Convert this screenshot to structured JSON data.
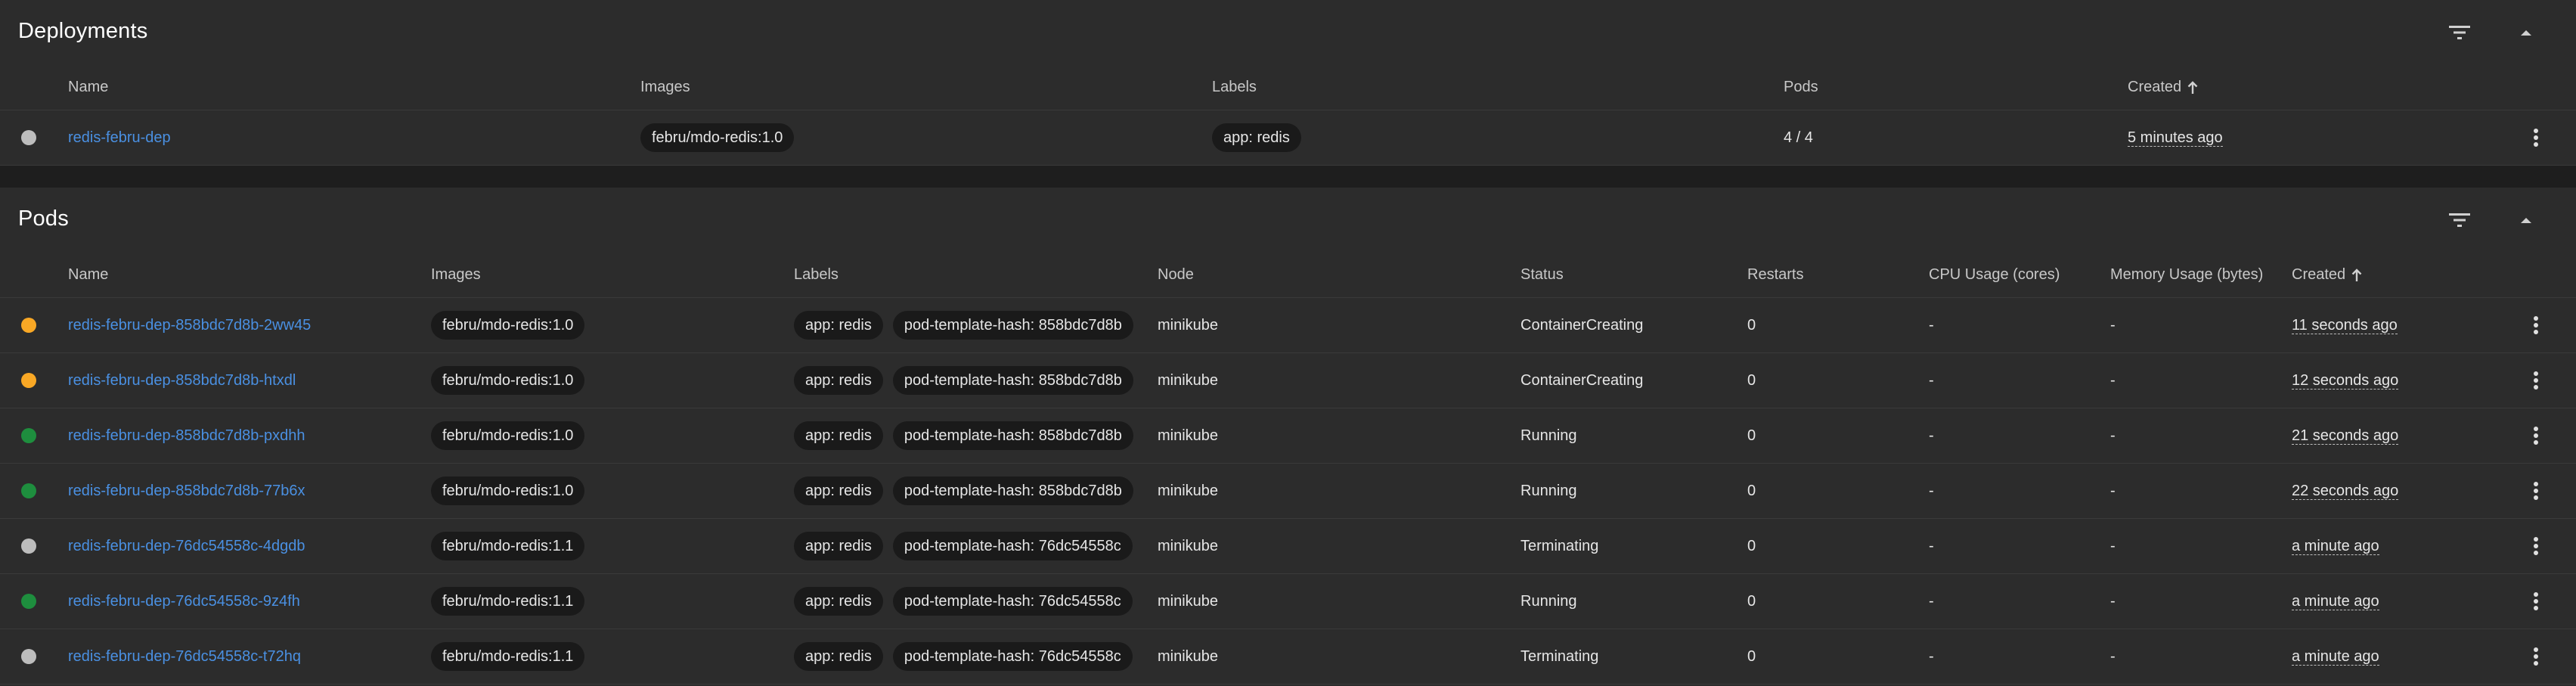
{
  "deployments": {
    "title": "Deployments",
    "columns": {
      "name": "Name",
      "images": "Images",
      "labels": "Labels",
      "pods": "Pods",
      "created": "Created"
    },
    "rows": [
      {
        "status_color": "#bdbdbd",
        "name": "redis-febru-dep",
        "images": [
          "febru/mdo-redis:1.0"
        ],
        "labels": [
          "app: redis"
        ],
        "pods": "4 / 4",
        "created": "5 minutes ago"
      }
    ]
  },
  "pods": {
    "title": "Pods",
    "columns": {
      "name": "Name",
      "images": "Images",
      "labels": "Labels",
      "node": "Node",
      "status": "Status",
      "restarts": "Restarts",
      "cpu": "CPU Usage (cores)",
      "memory": "Memory Usage (bytes)",
      "created": "Created"
    },
    "rows": [
      {
        "status_color": "#f9a825",
        "name": "redis-febru-dep-858bdc7d8b-2ww45",
        "image": "febru/mdo-redis:1.0",
        "labels": [
          "app: redis",
          "pod-template-hash: 858bdc7d8b"
        ],
        "node": "minikube",
        "status": "ContainerCreating",
        "restarts": "0",
        "cpu": "-",
        "memory": "-",
        "created": "11 seconds ago"
      },
      {
        "status_color": "#f9a825",
        "name": "redis-febru-dep-858bdc7d8b-htxdl",
        "image": "febru/mdo-redis:1.0",
        "labels": [
          "app: redis",
          "pod-template-hash: 858bdc7d8b"
        ],
        "node": "minikube",
        "status": "ContainerCreating",
        "restarts": "0",
        "cpu": "-",
        "memory": "-",
        "created": "12 seconds ago"
      },
      {
        "status_color": "#1e8e3e",
        "name": "redis-febru-dep-858bdc7d8b-pxdhh",
        "image": "febru/mdo-redis:1.0",
        "labels": [
          "app: redis",
          "pod-template-hash: 858bdc7d8b"
        ],
        "node": "minikube",
        "status": "Running",
        "restarts": "0",
        "cpu": "-",
        "memory": "-",
        "created": "21 seconds ago"
      },
      {
        "status_color": "#1e8e3e",
        "name": "redis-febru-dep-858bdc7d8b-77b6x",
        "image": "febru/mdo-redis:1.0",
        "labels": [
          "app: redis",
          "pod-template-hash: 858bdc7d8b"
        ],
        "node": "minikube",
        "status": "Running",
        "restarts": "0",
        "cpu": "-",
        "memory": "-",
        "created": "22 seconds ago"
      },
      {
        "status_color": "#bdbdbd",
        "name": "redis-febru-dep-76dc54558c-4dgdb",
        "image": "febru/mdo-redis:1.1",
        "labels": [
          "app: redis",
          "pod-template-hash: 76dc54558c"
        ],
        "node": "minikube",
        "status": "Terminating",
        "restarts": "0",
        "cpu": "-",
        "memory": "-",
        "created": "a minute ago"
      },
      {
        "status_color": "#1e8e3e",
        "name": "redis-febru-dep-76dc54558c-9z4fh",
        "image": "febru/mdo-redis:1.1",
        "labels": [
          "app: redis",
          "pod-template-hash: 76dc54558c"
        ],
        "node": "minikube",
        "status": "Running",
        "restarts": "0",
        "cpu": "-",
        "memory": "-",
        "created": "a minute ago"
      },
      {
        "status_color": "#bdbdbd",
        "name": "redis-febru-dep-76dc54558c-t72hq",
        "image": "febru/mdo-redis:1.1",
        "labels": [
          "app: redis",
          "pod-template-hash: 76dc54558c"
        ],
        "node": "minikube",
        "status": "Terminating",
        "restarts": "0",
        "cpu": "-",
        "memory": "-",
        "created": "a minute ago"
      }
    ]
  }
}
